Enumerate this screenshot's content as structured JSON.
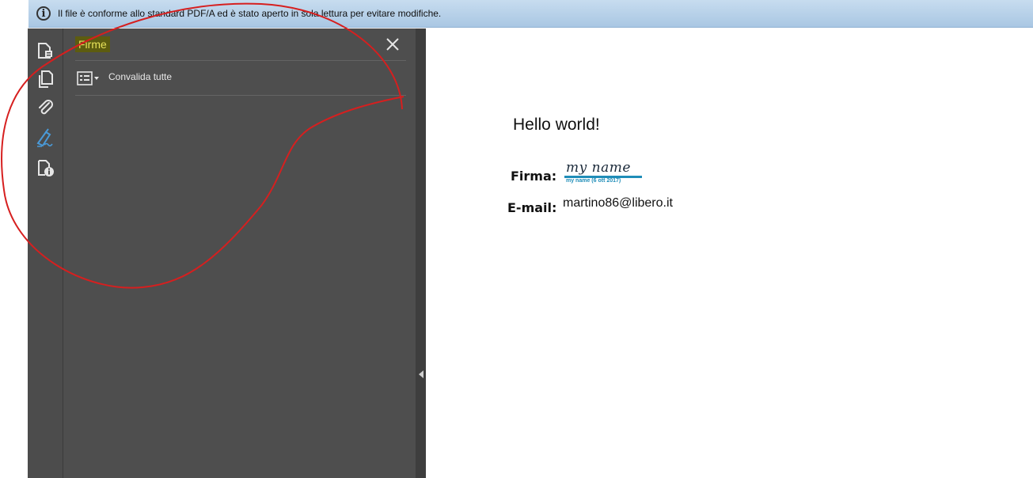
{
  "infobar": {
    "icon": "info-icon",
    "message": "Il file è conforme allo standard PDF/A ed è stato aperto in sola lettura per evitare modifiche."
  },
  "tool_rail": {
    "items": [
      {
        "name": "document-properties-icon"
      },
      {
        "name": "pages-icon"
      },
      {
        "name": "attachment-icon"
      },
      {
        "name": "signature-pen-icon",
        "active": true,
        "color": "#4a9ad8"
      },
      {
        "name": "document-info-icon"
      }
    ]
  },
  "panel": {
    "title": "Firme",
    "close_icon": "close-icon",
    "options_icon": "list-options-icon",
    "validate_all_label": "Convalida tutte"
  },
  "document": {
    "heading": "Hello world!",
    "signature_label": "Firma:",
    "signature_name": "my name",
    "signature_caption": "my name (6 ott 2017)",
    "email_label": "E-mail:",
    "email_value": "martino86@libero.it"
  },
  "colors": {
    "annotation": "#d61f1f",
    "signature_accent": "#1f8db8",
    "title_highlight_bg": "#5d5c10",
    "title_highlight_text": "#e8e25a"
  }
}
